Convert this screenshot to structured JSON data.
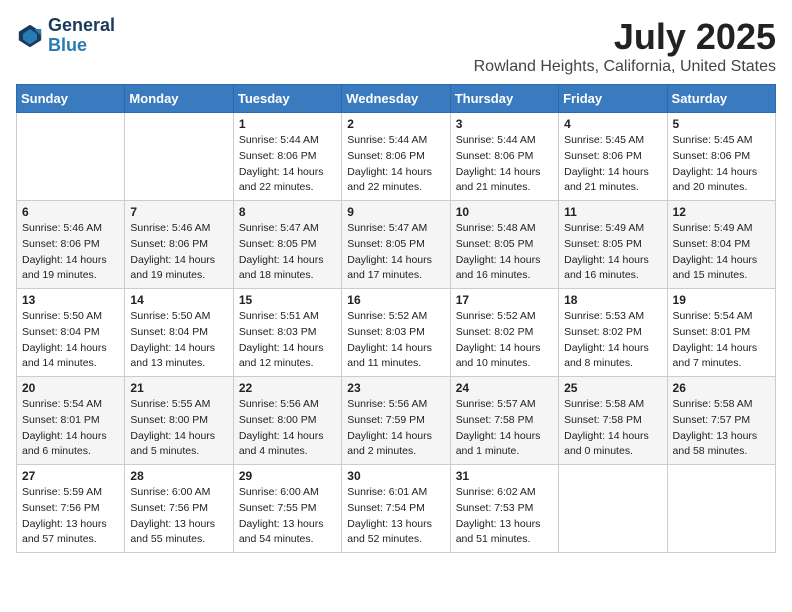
{
  "header": {
    "logo_line1": "General",
    "logo_line2": "Blue",
    "month": "July 2025",
    "location": "Rowland Heights, California, United States"
  },
  "days_of_week": [
    "Sunday",
    "Monday",
    "Tuesday",
    "Wednesday",
    "Thursday",
    "Friday",
    "Saturday"
  ],
  "weeks": [
    [
      {
        "day": "",
        "info": ""
      },
      {
        "day": "",
        "info": ""
      },
      {
        "day": "1",
        "info": "Sunrise: 5:44 AM\nSunset: 8:06 PM\nDaylight: 14 hours and 22 minutes."
      },
      {
        "day": "2",
        "info": "Sunrise: 5:44 AM\nSunset: 8:06 PM\nDaylight: 14 hours and 22 minutes."
      },
      {
        "day": "3",
        "info": "Sunrise: 5:44 AM\nSunset: 8:06 PM\nDaylight: 14 hours and 21 minutes."
      },
      {
        "day": "4",
        "info": "Sunrise: 5:45 AM\nSunset: 8:06 PM\nDaylight: 14 hours and 21 minutes."
      },
      {
        "day": "5",
        "info": "Sunrise: 5:45 AM\nSunset: 8:06 PM\nDaylight: 14 hours and 20 minutes."
      }
    ],
    [
      {
        "day": "6",
        "info": "Sunrise: 5:46 AM\nSunset: 8:06 PM\nDaylight: 14 hours and 19 minutes."
      },
      {
        "day": "7",
        "info": "Sunrise: 5:46 AM\nSunset: 8:06 PM\nDaylight: 14 hours and 19 minutes."
      },
      {
        "day": "8",
        "info": "Sunrise: 5:47 AM\nSunset: 8:05 PM\nDaylight: 14 hours and 18 minutes."
      },
      {
        "day": "9",
        "info": "Sunrise: 5:47 AM\nSunset: 8:05 PM\nDaylight: 14 hours and 17 minutes."
      },
      {
        "day": "10",
        "info": "Sunrise: 5:48 AM\nSunset: 8:05 PM\nDaylight: 14 hours and 16 minutes."
      },
      {
        "day": "11",
        "info": "Sunrise: 5:49 AM\nSunset: 8:05 PM\nDaylight: 14 hours and 16 minutes."
      },
      {
        "day": "12",
        "info": "Sunrise: 5:49 AM\nSunset: 8:04 PM\nDaylight: 14 hours and 15 minutes."
      }
    ],
    [
      {
        "day": "13",
        "info": "Sunrise: 5:50 AM\nSunset: 8:04 PM\nDaylight: 14 hours and 14 minutes."
      },
      {
        "day": "14",
        "info": "Sunrise: 5:50 AM\nSunset: 8:04 PM\nDaylight: 14 hours and 13 minutes."
      },
      {
        "day": "15",
        "info": "Sunrise: 5:51 AM\nSunset: 8:03 PM\nDaylight: 14 hours and 12 minutes."
      },
      {
        "day": "16",
        "info": "Sunrise: 5:52 AM\nSunset: 8:03 PM\nDaylight: 14 hours and 11 minutes."
      },
      {
        "day": "17",
        "info": "Sunrise: 5:52 AM\nSunset: 8:02 PM\nDaylight: 14 hours and 10 minutes."
      },
      {
        "day": "18",
        "info": "Sunrise: 5:53 AM\nSunset: 8:02 PM\nDaylight: 14 hours and 8 minutes."
      },
      {
        "day": "19",
        "info": "Sunrise: 5:54 AM\nSunset: 8:01 PM\nDaylight: 14 hours and 7 minutes."
      }
    ],
    [
      {
        "day": "20",
        "info": "Sunrise: 5:54 AM\nSunset: 8:01 PM\nDaylight: 14 hours and 6 minutes."
      },
      {
        "day": "21",
        "info": "Sunrise: 5:55 AM\nSunset: 8:00 PM\nDaylight: 14 hours and 5 minutes."
      },
      {
        "day": "22",
        "info": "Sunrise: 5:56 AM\nSunset: 8:00 PM\nDaylight: 14 hours and 4 minutes."
      },
      {
        "day": "23",
        "info": "Sunrise: 5:56 AM\nSunset: 7:59 PM\nDaylight: 14 hours and 2 minutes."
      },
      {
        "day": "24",
        "info": "Sunrise: 5:57 AM\nSunset: 7:58 PM\nDaylight: 14 hours and 1 minute."
      },
      {
        "day": "25",
        "info": "Sunrise: 5:58 AM\nSunset: 7:58 PM\nDaylight: 14 hours and 0 minutes."
      },
      {
        "day": "26",
        "info": "Sunrise: 5:58 AM\nSunset: 7:57 PM\nDaylight: 13 hours and 58 minutes."
      }
    ],
    [
      {
        "day": "27",
        "info": "Sunrise: 5:59 AM\nSunset: 7:56 PM\nDaylight: 13 hours and 57 minutes."
      },
      {
        "day": "28",
        "info": "Sunrise: 6:00 AM\nSunset: 7:56 PM\nDaylight: 13 hours and 55 minutes."
      },
      {
        "day": "29",
        "info": "Sunrise: 6:00 AM\nSunset: 7:55 PM\nDaylight: 13 hours and 54 minutes."
      },
      {
        "day": "30",
        "info": "Sunrise: 6:01 AM\nSunset: 7:54 PM\nDaylight: 13 hours and 52 minutes."
      },
      {
        "day": "31",
        "info": "Sunrise: 6:02 AM\nSunset: 7:53 PM\nDaylight: 13 hours and 51 minutes."
      },
      {
        "day": "",
        "info": ""
      },
      {
        "day": "",
        "info": ""
      }
    ]
  ]
}
